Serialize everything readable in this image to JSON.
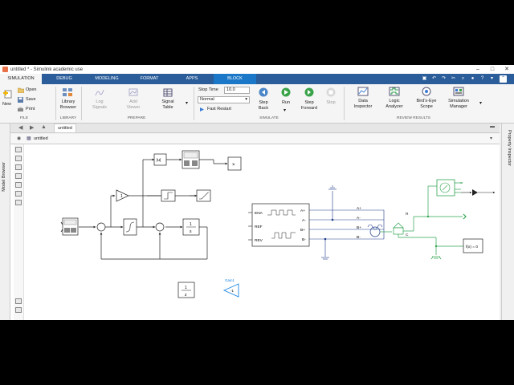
{
  "window": {
    "title": "untitled * - Simulink academic use"
  },
  "tabs": [
    "SIMULATION",
    "DEBUG",
    "MODELING",
    "FORMAT",
    "APPS",
    "BLOCK"
  ],
  "ribbon": {
    "file": {
      "new": "New",
      "open": "Open",
      "save": "Save",
      "print": "Print",
      "section": "FILE"
    },
    "library": {
      "library_browser_1": "Library",
      "library_browser_2": "Browser",
      "section": "LIBRARY"
    },
    "prepare": {
      "log_1": "Log",
      "log_2": "Signals",
      "add_1": "Add",
      "add_2": "Viewer",
      "table_1": "Signal",
      "table_2": "Table",
      "section": "PREPARE"
    },
    "simulate": {
      "stop_time_label": "Stop Time",
      "stop_time_value": "10.0",
      "mode": "Normal",
      "fast_restart": "Fast Restart",
      "step_back_1": "Step",
      "step_back_2": "Back",
      "run": "Run",
      "step_fwd_1": "Step",
      "step_fwd_2": "Forward",
      "stop": "Stop",
      "section": "SIMULATE"
    },
    "review": {
      "data_1": "Data",
      "data_2": "Inspector",
      "logic_1": "Logic",
      "logic_2": "Analyzer",
      "birds_1": "Bird's-Eye",
      "birds_2": "Scope",
      "sim_1": "Simulation",
      "sim_2": "Manager",
      "section": "REVIEW RESULTS"
    }
  },
  "document": {
    "tab": "untitled",
    "breadcrumb": "untitled"
  },
  "side": {
    "left": "Model Browser",
    "right": "Property Inspector"
  },
  "diagram": {
    "abs": "|u|",
    "gain_one": "1",
    "integrator_num": "1",
    "integrator_den": "s",
    "tf_num": "1",
    "tf_den": "z",
    "product": "×",
    "gain2_label": "Gain1",
    "gain2_value": "-1",
    "fcn": "f(x) = 0",
    "ports": [
      "ENA",
      "REF",
      "REV",
      "A+",
      "A-",
      "B+",
      "B-"
    ],
    "wire_labels": [
      "A+",
      "A-",
      "B+",
      "B-"
    ],
    "r_label": "R",
    "c_label": "C"
  }
}
